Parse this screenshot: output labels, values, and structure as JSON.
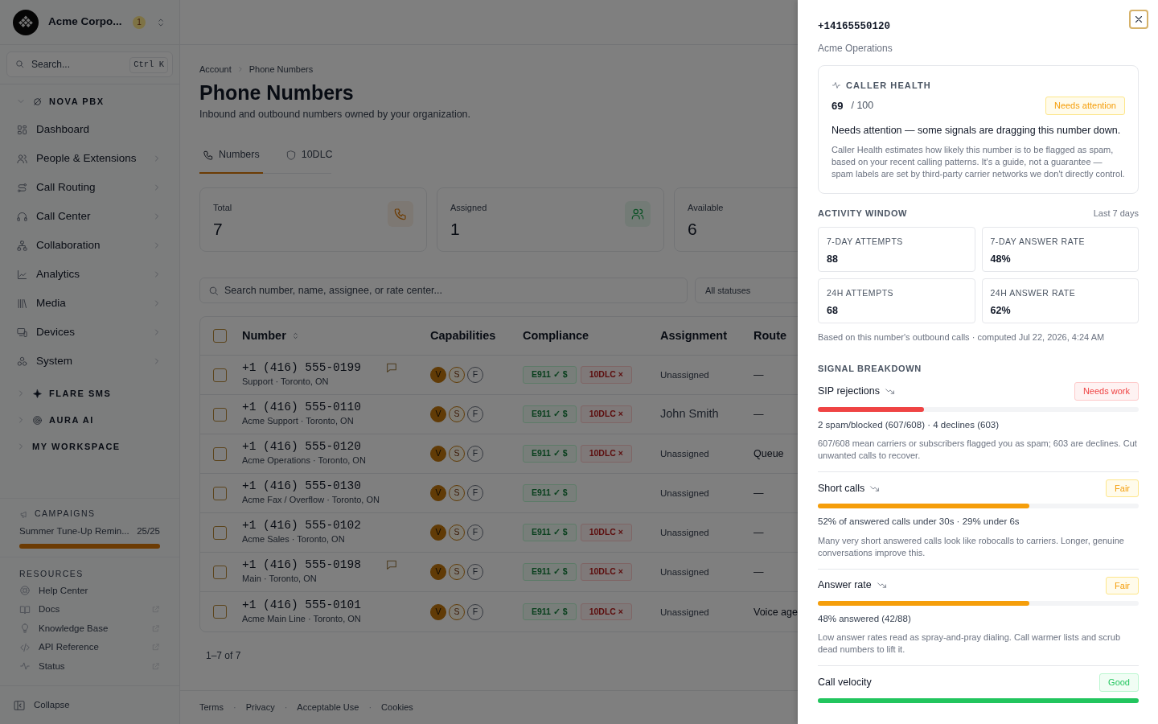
{
  "sidebar": {
    "org": {
      "name": "Acme Corpo...",
      "badge": "1"
    },
    "search": {
      "placeholder": "Search...",
      "shortcut": "Ctrl K"
    },
    "sections": [
      {
        "title": "NOVA PBX",
        "expanded": true,
        "items": [
          {
            "label": "Dashboard",
            "has_submenu": false
          },
          {
            "label": "People & Extensions",
            "has_submenu": true
          },
          {
            "label": "Call Routing",
            "has_submenu": true
          },
          {
            "label": "Call Center",
            "has_submenu": true
          },
          {
            "label": "Collaboration",
            "has_submenu": true
          },
          {
            "label": "Analytics",
            "has_submenu": true
          },
          {
            "label": "Media",
            "has_submenu": true
          },
          {
            "label": "Devices",
            "has_submenu": true
          },
          {
            "label": "System",
            "has_submenu": true
          }
        ]
      },
      {
        "title": "FLARE SMS",
        "expanded": false
      },
      {
        "title": "AURA AI",
        "expanded": false
      },
      {
        "title": "MY WORKSPACE",
        "expanded": false
      }
    ],
    "campaigns": {
      "title": "CAMPAIGNS",
      "items": [
        {
          "name": "Summer Tune-Up Remin...",
          "count": "25/25",
          "level": 1
        }
      ]
    },
    "resources": {
      "title": "RESOURCES",
      "items": [
        {
          "label": "Help Center",
          "external": false
        },
        {
          "label": "Docs",
          "external": true
        },
        {
          "label": "Knowledge Base",
          "external": true
        },
        {
          "label": "API Reference",
          "external": true
        },
        {
          "label": "Status",
          "external": true
        }
      ]
    },
    "collapse": "Collapse"
  },
  "main": {
    "breadcrumb": [
      "Account",
      "Phone Numbers"
    ],
    "title": "Phone Numbers",
    "subtitle": "Inbound and outbound numbers owned by your organization.",
    "tabs": [
      {
        "label": "Numbers",
        "selected": true
      },
      {
        "label": "10DLC",
        "selected": false
      }
    ],
    "stats": [
      {
        "label": "Total",
        "value": "7",
        "has_icon": true
      },
      {
        "label": "Assigned",
        "value": "1",
        "has_icon": true
      },
      {
        "label": "Available",
        "value": "6",
        "has_icon": false
      }
    ],
    "search": {
      "placeholder": "Search number, name, assignee, or rate center..."
    },
    "filter": "All statuses",
    "select_all": false,
    "columns": [
      {
        "label": "Number",
        "sortable": true
      },
      {
        "label": "Capabilities",
        "sortable": false
      },
      {
        "label": "Compliance",
        "sortable": false
      },
      {
        "label": "Assignment",
        "sortable": false
      },
      {
        "label": "Route",
        "sortable": false
      }
    ],
    "rows": [
      {
        "selected": false,
        "number": "+1 (416) 555-0199",
        "detail": "Support · Toronto, ON",
        "sms": true,
        "capabilities": [
          {
            "letter": "V",
            "kind": "filled"
          },
          {
            "letter": "S",
            "kind": "outlined"
          },
          {
            "letter": "F",
            "kind": "off"
          }
        ],
        "compliance": [
          {
            "label": "E911 ✓ $",
            "kind": "ok"
          },
          {
            "label": "10DLC ×",
            "kind": "fail"
          }
        ],
        "assignment": "Unassigned",
        "assigned": false,
        "route": "—"
      },
      {
        "selected": false,
        "number": "+1 (416) 555-0110",
        "detail": "Acme Support · Toronto, ON",
        "sms": false,
        "capabilities": [
          {
            "letter": "V",
            "kind": "filled"
          },
          {
            "letter": "S",
            "kind": "outlined"
          },
          {
            "letter": "F",
            "kind": "off"
          }
        ],
        "compliance": [
          {
            "label": "E911 ✓ $",
            "kind": "ok"
          },
          {
            "label": "10DLC ×",
            "kind": "fail"
          }
        ],
        "assignment": "John Smith",
        "assigned": true,
        "route": "—"
      },
      {
        "selected": false,
        "number": "+1 (416) 555-0120",
        "detail": "Acme Operations · Toronto, ON",
        "sms": false,
        "capabilities": [
          {
            "letter": "V",
            "kind": "filled"
          },
          {
            "letter": "S",
            "kind": "outlined"
          },
          {
            "letter": "F",
            "kind": "off"
          }
        ],
        "compliance": [
          {
            "label": "E911 ✓ $",
            "kind": "ok"
          },
          {
            "label": "10DLC ×",
            "kind": "fail"
          }
        ],
        "assignment": "Unassigned",
        "assigned": false,
        "route": "Queue"
      },
      {
        "selected": false,
        "number": "+1 (416) 555-0130",
        "detail": "Acme Fax / Overflow · Toronto, ON",
        "sms": false,
        "capabilities": [
          {
            "letter": "V",
            "kind": "filled"
          },
          {
            "letter": "S",
            "kind": "outlined"
          },
          {
            "letter": "F",
            "kind": "off"
          }
        ],
        "compliance": [
          {
            "label": "E911 ✓ $",
            "kind": "ok"
          }
        ],
        "assignment": "Unassigned",
        "assigned": false,
        "route": "—"
      },
      {
        "selected": false,
        "number": "+1 (416) 555-0102",
        "detail": "Acme Sales · Toronto, ON",
        "sms": false,
        "capabilities": [
          {
            "letter": "V",
            "kind": "filled"
          },
          {
            "letter": "S",
            "kind": "outlined"
          },
          {
            "letter": "F",
            "kind": "off"
          }
        ],
        "compliance": [
          {
            "label": "E911 ✓ $",
            "kind": "ok"
          },
          {
            "label": "10DLC ×",
            "kind": "fail"
          }
        ],
        "assignment": "Unassigned",
        "assigned": false,
        "route": "—"
      },
      {
        "selected": false,
        "number": "+1 (416) 555-0198",
        "detail": "Main · Toronto, ON",
        "sms": true,
        "capabilities": [
          {
            "letter": "V",
            "kind": "filled"
          },
          {
            "letter": "S",
            "kind": "outlined"
          },
          {
            "letter": "F",
            "kind": "off"
          }
        ],
        "compliance": [
          {
            "label": "E911 ✓ $",
            "kind": "ok"
          },
          {
            "label": "10DLC ×",
            "kind": "fail"
          }
        ],
        "assignment": "Unassigned",
        "assigned": false,
        "route": "—"
      },
      {
        "selected": false,
        "number": "+1 (416) 555-0101",
        "detail": "Acme Main Line · Toronto, ON",
        "sms": false,
        "capabilities": [
          {
            "letter": "V",
            "kind": "filled"
          },
          {
            "letter": "S",
            "kind": "outlined"
          },
          {
            "letter": "F",
            "kind": "off"
          }
        ],
        "compliance": [
          {
            "label": "E911 ✓ $",
            "kind": "ok"
          },
          {
            "label": "10DLC ×",
            "kind": "fail"
          }
        ],
        "assignment": "Unassigned",
        "assigned": false,
        "route": "Voice age"
      }
    ],
    "pagination": "1–7 of 7",
    "footer": [
      {
        "kind": "link",
        "text": "Terms"
      },
      {
        "kind": "separator",
        "text": "·"
      },
      {
        "kind": "link",
        "text": "Privacy"
      },
      {
        "kind": "separator",
        "text": "·"
      },
      {
        "kind": "link",
        "text": "Acceptable Use"
      },
      {
        "kind": "separator",
        "text": "·"
      },
      {
        "kind": "link",
        "text": "Cookies"
      }
    ]
  },
  "panel": {
    "number": "+14165550120",
    "name": "Acme Operations",
    "health": {
      "title": "CALLER HEALTH",
      "score": "69",
      "max": "/ 100",
      "status": {
        "label": "Needs attention",
        "kind": "warning"
      },
      "headline": "Needs attention — some signals are dragging this number down.",
      "description": "Caller Health estimates how likely this number is to be flagged as spam, based on your recent calling patterns. It's a guide, not a guarantee — spam labels are set by third-party carrier networks we don't directly control."
    },
    "activity": {
      "title": "ACTIVITY WINDOW",
      "period": "Last 7 days",
      "metrics": [
        {
          "label": "7-DAY ATTEMPTS",
          "value": "88"
        },
        {
          "label": "7-DAY ANSWER RATE",
          "value": "48%"
        },
        {
          "label": "24H ATTEMPTS",
          "value": "68"
        },
        {
          "label": "24H ANSWER RATE",
          "value": "62%"
        }
      ],
      "note": "Based on this number's outbound calls · computed Jul 22, 2026, 4:24 AM"
    },
    "signals": {
      "title": "SIGNAL BREAKDOWN",
      "items": [
        {
          "name": "SIP rejections",
          "trend_down": true,
          "status": {
            "label": "Needs work",
            "kind": "danger"
          },
          "level": 0.33,
          "summary": "2 spam/blocked (607/608) · 4 declines (603)",
          "description": "607/608 mean carriers or subscribers flagged you as spam; 603 are declines. Cut unwanted calls to recover."
        },
        {
          "name": "Short calls",
          "trend_down": true,
          "status": {
            "label": "Fair",
            "kind": "warning"
          },
          "level": 0.66,
          "summary": "52% of answered calls under 30s · 29% under 6s",
          "description": "Many very short answered calls look like robocalls to carriers. Longer, genuine conversations improve this."
        },
        {
          "name": "Answer rate",
          "trend_down": true,
          "status": {
            "label": "Fair",
            "kind": "warning"
          },
          "level": 0.66,
          "summary": "48% answered (42/88)",
          "description": "Low answer rates read as spray-and-pray dialing. Call warmer lists and scrub dead numbers to lift it."
        },
        {
          "name": "Call velocity",
          "trend_down": false,
          "status": {
            "label": "Good",
            "kind": "success"
          },
          "level": 1
        }
      ]
    }
  }
}
